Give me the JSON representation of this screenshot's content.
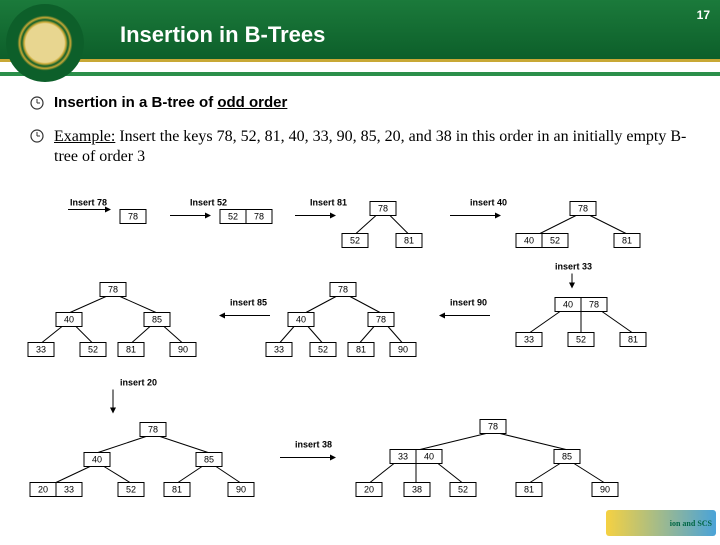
{
  "header": {
    "title": "Insertion in B-Trees",
    "page_number": "17"
  },
  "heading_prefix": "Insertion in a B-tree of ",
  "heading_underlined": "odd order",
  "example_prefix": "Example:",
  "example_text": " Insert the keys 78, 52, 81, 40, 33, 90, 85, 20, and 38 in this order in an initially empty B-tree of order 3",
  "labels": {
    "i78": "Insert 78",
    "i52": "Insert 52",
    "i81": "Insert 81",
    "i40": "insert 40",
    "i33": "insert 33",
    "i85": "insert 85",
    "i90": "insert 90",
    "i20": "insert 20",
    "i38": "insert 38"
  },
  "v": {
    "n20": "20",
    "n33": "33",
    "n38": "38",
    "n40": "40",
    "n52": "52",
    "n78": "78",
    "n81": "81",
    "n85": "85",
    "n90": "90"
  },
  "corner": "ion and   SCS"
}
